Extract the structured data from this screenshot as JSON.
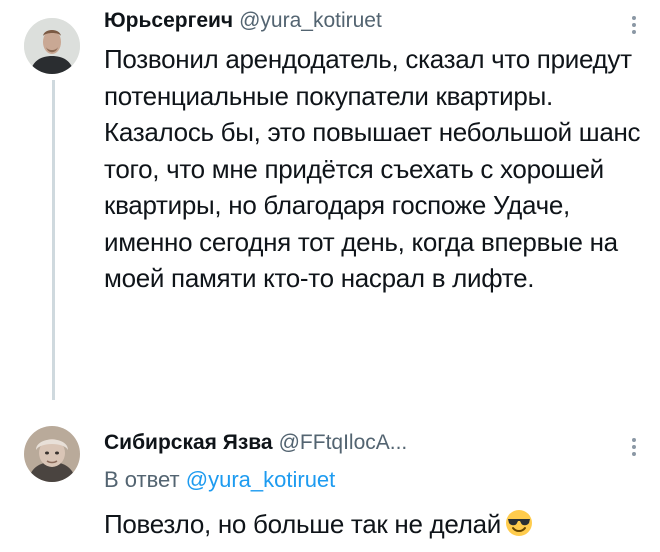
{
  "tweets": [
    {
      "author_name": "Юрьсергеич",
      "author_handle": "@yura_kotiruet",
      "text": "Позвонил арендодатель, сказал что приедут потенциальные покупатели квартиры. Казалось бы, это повышает небольшой шанс того, что мне придётся съехать с хорошей квартиры, но благодаря госпоже Удаче, именно сегодня тот день, когда впервые на моей памяти кто-то насрал в лифте."
    },
    {
      "author_name": "Сибирская Язва",
      "author_handle": "@FFtqIlocA...",
      "reply_prefix": "В ответ",
      "reply_mention": "@yura_kotiruet",
      "text": "Повезло, но больше так не делай",
      "emoji": "smiling-face-with-sunglasses-icon"
    }
  ],
  "colors": {
    "text": "#0f1419",
    "secondary": "#536471",
    "link": "#1d9bf0",
    "thread_line": "#cfd9de"
  }
}
